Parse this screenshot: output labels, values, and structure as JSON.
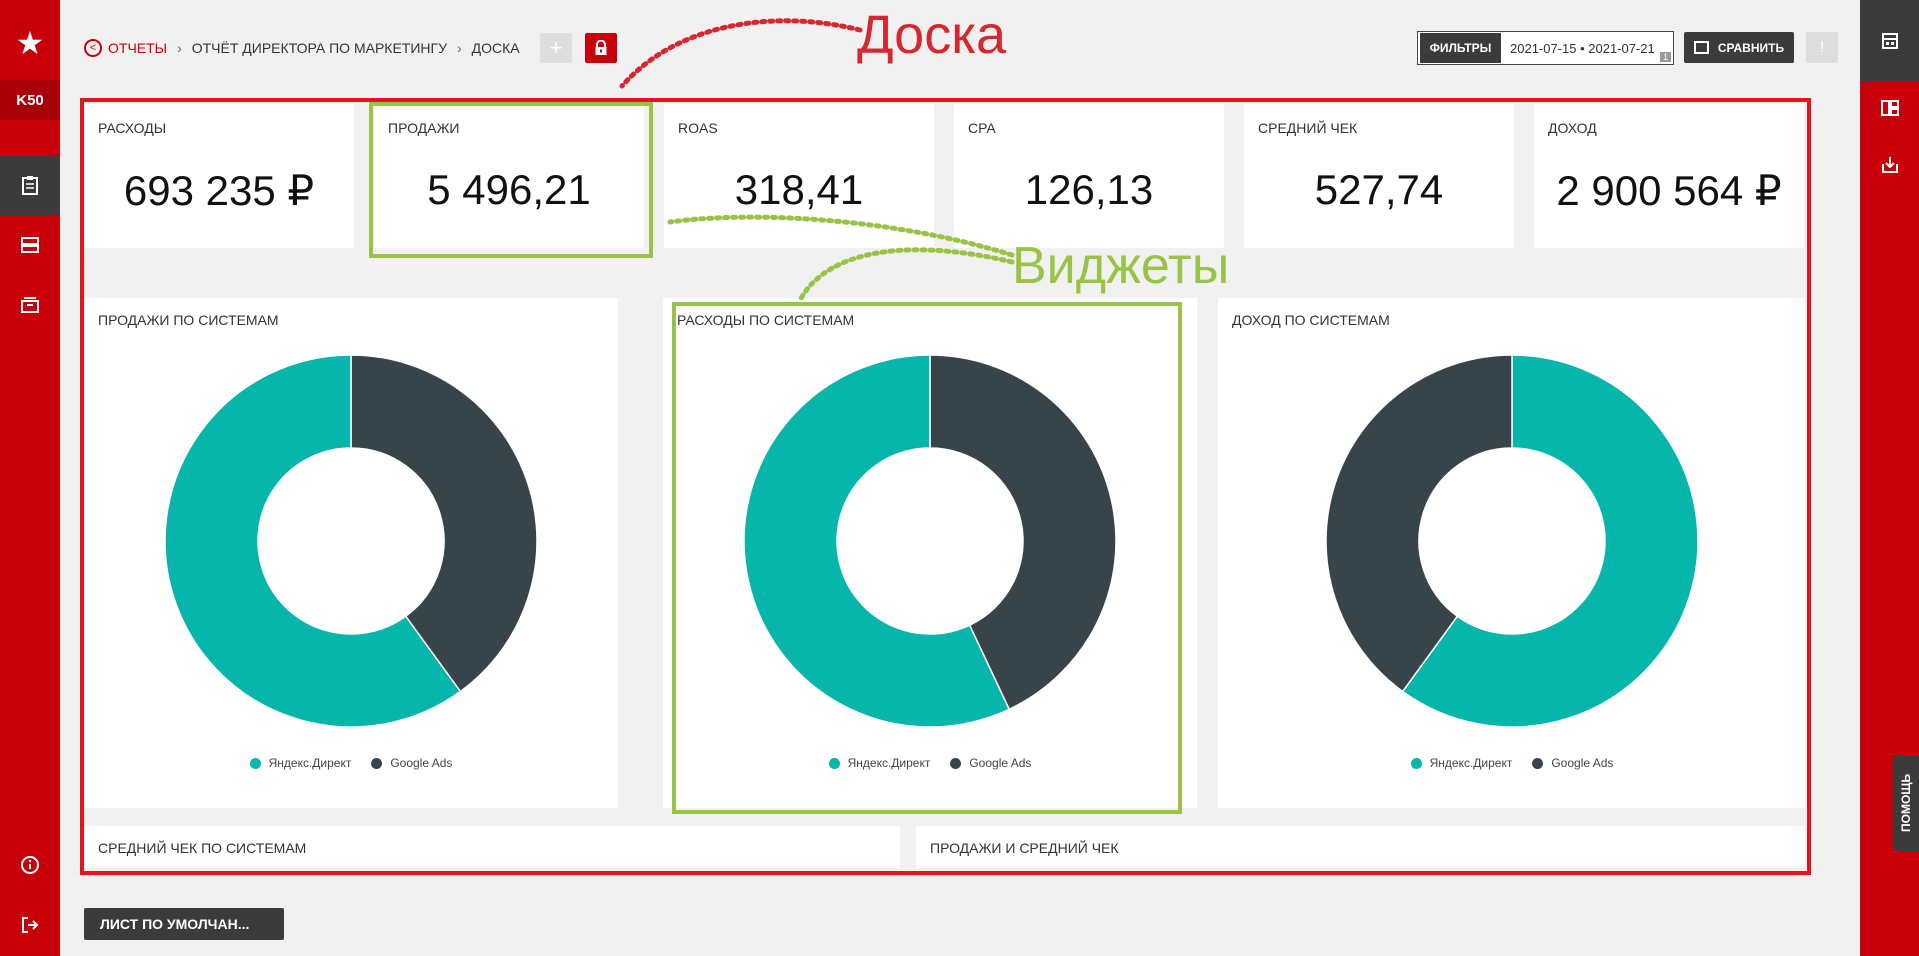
{
  "sidebar": {
    "brand": "K50"
  },
  "breadcrumb": {
    "root": "ОТЧЕТЫ",
    "report": "ОТЧЁТ ДИРЕКТОРА ПО МАРКЕТИНГУ",
    "board": "ДОСКА"
  },
  "toolbar": {
    "filters_label": "ФИЛЬТРЫ",
    "date_range": "2021-07-15 • 2021-07-21",
    "filter_badge": "1",
    "compare_label": "СРАВНИТЬ",
    "alert_label": "!"
  },
  "annotations": {
    "board": "Доска",
    "widgets": "Виджеты"
  },
  "kpis": [
    {
      "label": "РАСХОДЫ",
      "value": "693 235 ₽"
    },
    {
      "label": "ПРОДАЖИ",
      "value": "5 496,21"
    },
    {
      "label": "ROAS",
      "value": "318,41"
    },
    {
      "label": "CPA",
      "value": "126,13"
    },
    {
      "label": "СРЕДНИЙ ЧЕК",
      "value": "527,74"
    },
    {
      "label": "ДОХОД",
      "value": "2 900 564 ₽"
    }
  ],
  "colors": {
    "yandex": "#06b6aa",
    "google": "#37454a",
    "accent": "#c8000a"
  },
  "chart_data": [
    {
      "type": "pie",
      "title": "ПРОДАЖИ ПО СИСТЕМАМ",
      "donut": true,
      "categories": [
        "Яндекс.Директ",
        "Google Ads"
      ],
      "values": [
        60,
        40
      ],
      "start_with": "Google Ads"
    },
    {
      "type": "pie",
      "title": "РАСХОДЫ ПО СИСТЕМАМ",
      "donut": true,
      "categories": [
        "Яндекс.Директ",
        "Google Ads"
      ],
      "values": [
        57,
        43
      ],
      "start_with": "Google Ads"
    },
    {
      "type": "pie",
      "title": "ДОХОД ПО СИСТЕМАМ",
      "donut": true,
      "categories": [
        "Яндекс.Директ",
        "Google Ads"
      ],
      "values": [
        60,
        40
      ],
      "start_with": "Яндекс.Директ"
    }
  ],
  "bottom_widgets": [
    "СРЕДНИЙ ЧЕК ПО СИСТЕМАМ",
    "ПРОДАЖИ И СРЕДНИЙ ЧЕК"
  ],
  "sheet_tab": "ЛИСТ ПО УМОЛЧАН...",
  "help_label": "ПОМОЩЬ"
}
